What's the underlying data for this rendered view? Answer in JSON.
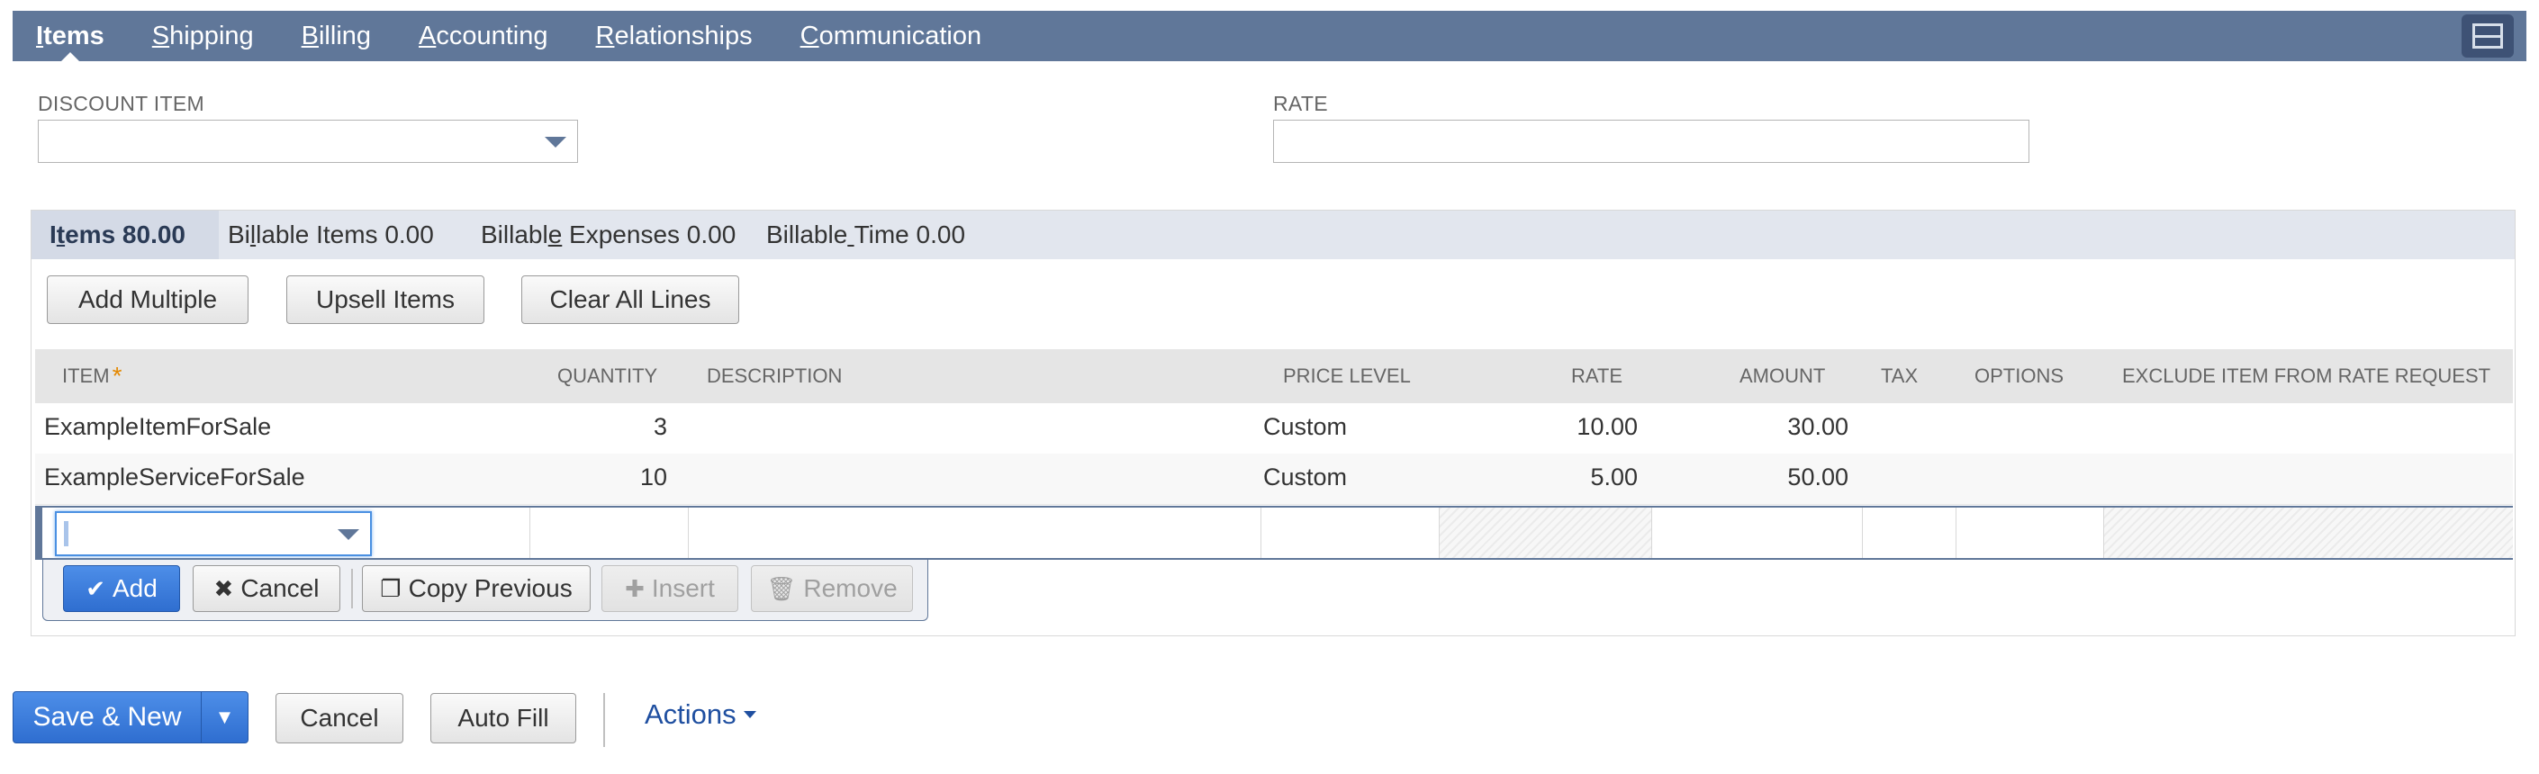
{
  "top_tabs": [
    {
      "label_pre": "",
      "label_ul": "I",
      "label_post": "tems",
      "active": true
    },
    {
      "label_pre": "",
      "label_ul": "S",
      "label_post": "hipping",
      "active": false
    },
    {
      "label_pre": "",
      "label_ul": "B",
      "label_post": "illing",
      "active": false
    },
    {
      "label_pre": "",
      "label_ul": "A",
      "label_post": "ccounting",
      "active": false
    },
    {
      "label_pre": "",
      "label_ul": "R",
      "label_post": "elationships",
      "active": false
    },
    {
      "label_pre": "",
      "label_ul": "C",
      "label_post": "ommunication",
      "active": false
    }
  ],
  "layout_icon": "layout-toggle-icon",
  "discount": {
    "label": "DISCOUNT ITEM",
    "value": ""
  },
  "rate": {
    "label": "RATE",
    "value": ""
  },
  "subtabs": [
    {
      "pre": "I",
      "ul": "t",
      "post": "ems 80.00",
      "active": true
    },
    {
      "pre": "Bi",
      "ul": "l",
      "post": "lable Items 0.00",
      "active": false
    },
    {
      "pre": "Billabl",
      "ul": "e",
      "post": " Expenses 0.00",
      "active": false
    },
    {
      "pre": "Billable",
      "ul": " ",
      "post": "Time 0.00",
      "active": false
    }
  ],
  "sublist_buttons": {
    "add_multiple": "Add Multiple",
    "upsell_items": "Upsell Items",
    "clear_all_lines": "Clear All Lines"
  },
  "columns": {
    "item": "ITEM",
    "required_mark": "*",
    "quantity": "QUANTITY",
    "description": "DESCRIPTION",
    "price_level": "PRICE LEVEL",
    "rate": "RATE",
    "amount": "AMOUNT",
    "tax": "TAX",
    "options": "OPTIONS",
    "exclude": "EXCLUDE ITEM FROM RATE REQUEST"
  },
  "rows": [
    {
      "item": "ExampleItemForSale",
      "quantity": "3",
      "description": "",
      "price_level": "Custom",
      "rate": "10.00",
      "amount": "30.00"
    },
    {
      "item": "ExampleServiceForSale",
      "quantity": "10",
      "description": "",
      "price_level": "Custom",
      "rate": "5.00",
      "amount": "50.00"
    }
  ],
  "edit_toolbar": {
    "add": "Add",
    "cancel": "Cancel",
    "copy_previous": "Copy Previous",
    "insert": "Insert",
    "remove": "Remove"
  },
  "bottom": {
    "save_new": "Save & New",
    "cancel": "Cancel",
    "auto_fill": "Auto Fill",
    "actions": "Actions"
  },
  "colors": {
    "tabbar": "#607799",
    "primary_button": "#2f6ed0",
    "link": "#1f4fa0",
    "required": "#e48800"
  }
}
